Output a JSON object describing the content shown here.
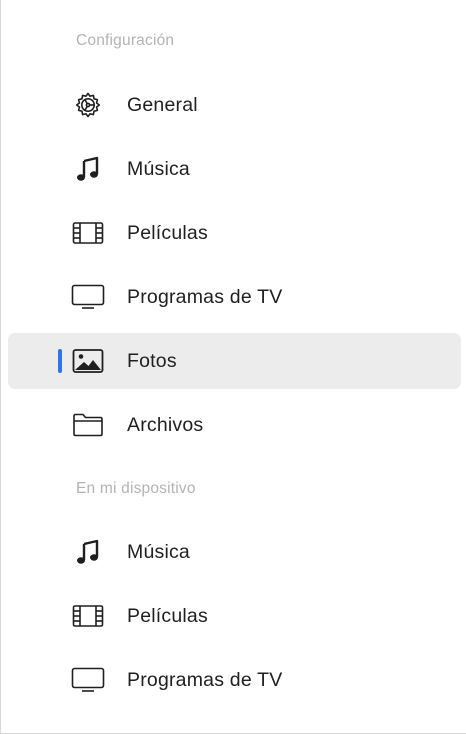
{
  "sections": [
    {
      "header": "Configuración",
      "items": [
        {
          "label": "General",
          "icon": "gear-icon",
          "selected": false
        },
        {
          "label": "Música",
          "icon": "music-note-icon",
          "selected": false
        },
        {
          "label": "Películas",
          "icon": "film-icon",
          "selected": false
        },
        {
          "label": "Programas de TV",
          "icon": "tv-icon",
          "selected": false
        },
        {
          "label": "Fotos",
          "icon": "photo-icon",
          "selected": true
        },
        {
          "label": "Archivos",
          "icon": "folder-icon",
          "selected": false
        }
      ]
    },
    {
      "header": "En mi dispositivo",
      "items": [
        {
          "label": "Música",
          "icon": "music-note-icon",
          "selected": false
        },
        {
          "label": "Películas",
          "icon": "film-icon",
          "selected": false
        },
        {
          "label": "Programas de TV",
          "icon": "tv-icon",
          "selected": false
        }
      ]
    }
  ],
  "colors": {
    "selection_indicator": "#2f74e8",
    "selected_background": "#ececec",
    "section_header_text": "#b3b3b3",
    "item_text": "#1f1f1f"
  }
}
